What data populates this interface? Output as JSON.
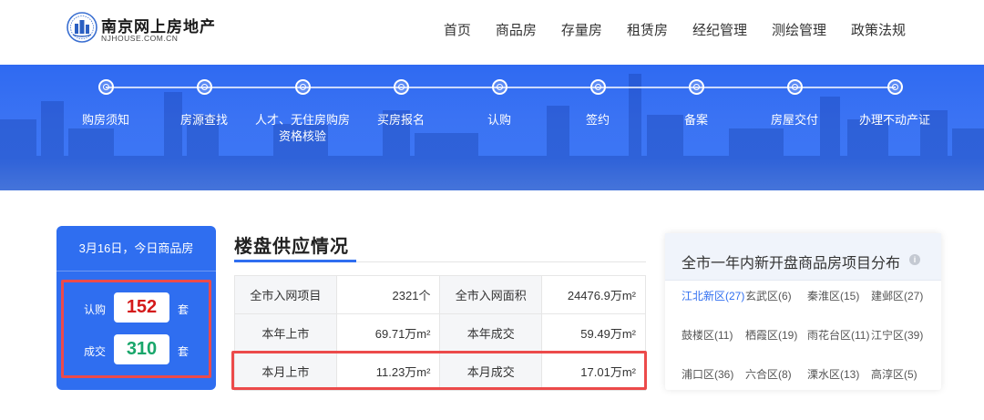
{
  "header": {
    "logo_title": "南京网上房地产",
    "logo_sub": "NJHOUSE.COM.CN",
    "nav": [
      "首页",
      "商品房",
      "存量房",
      "租赁房",
      "经纪管理",
      "测绘管理",
      "政策法规"
    ]
  },
  "steps": [
    {
      "label": "购房须知"
    },
    {
      "label": "房源查找"
    },
    {
      "label": "人才、无住房购房\n资格核验"
    },
    {
      "label": "买房报名"
    },
    {
      "label": "认购"
    },
    {
      "label": "签约"
    },
    {
      "label": "备案"
    },
    {
      "label": "房屋交付"
    },
    {
      "label": "办理不动产证"
    }
  ],
  "daily": {
    "date_text": "3月16日，今日商品房",
    "subscribe_label": "认购",
    "subscribe_value": "152",
    "deal_label": "成交",
    "deal_value": "310",
    "unit": "套"
  },
  "supply": {
    "title": "楼盘供应情况",
    "rows": [
      [
        {
          "k": "全市入网项目",
          "v": "2321个"
        },
        {
          "k": "全市入网面积",
          "v": "24476.9万m²"
        }
      ],
      [
        {
          "k": "本年上市",
          "v": "69.71万m²"
        },
        {
          "k": "本年成交",
          "v": "59.49万m²"
        }
      ],
      [
        {
          "k": "本月上市",
          "v": "11.23万m²"
        },
        {
          "k": "本月成交",
          "v": "17.01万m²"
        }
      ]
    ]
  },
  "distribution": {
    "title": "全市一年内新开盘商品房项目分布",
    "info_glyph": "i",
    "districts": [
      "江北新区(27)",
      "玄武区(6)",
      "秦淮区(15)",
      "建邺区(27)",
      "鼓楼区(11)",
      "栖霞区(19)",
      "雨花台区(11)",
      "江宁区(39)",
      "浦口区(36)",
      "六合区(8)",
      "溧水区(13)",
      "高淳区(5)"
    ]
  }
}
